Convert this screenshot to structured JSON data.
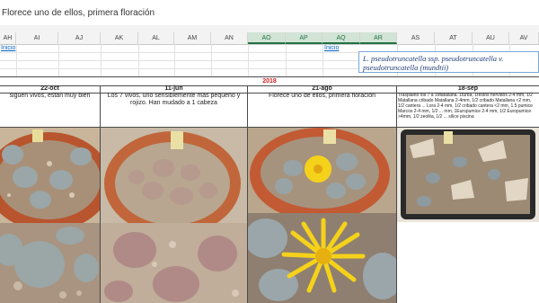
{
  "formula_bar": {
    "value": "Florece uno de ellos, primera floración"
  },
  "columns": [
    "AH",
    "AI",
    "AJ",
    "AK",
    "AL",
    "AM",
    "AN",
    "AO",
    "AP",
    "AQ",
    "AR",
    "AS",
    "AT",
    "AU",
    "AV"
  ],
  "links": {
    "left": "Inicio",
    "right": "Inicio"
  },
  "species_label": "L. pseudotruncatella ssp. pseudotruncatella v. pseudotruncatella (mundtii)",
  "year": "2018",
  "entries": [
    {
      "date": "22-oct",
      "note": "siguen vivos, están muy bien"
    },
    {
      "date": "11-jun",
      "note": "Los 7 vivos, uno sensiblemente más pequeño y rojizo. Han mudado a 1 cabeza"
    },
    {
      "date": "21-ago",
      "note": "Florece uno de ellos, primera floración"
    },
    {
      "date": "18-sep",
      "note": "Trasplanto los 7 a 1Matallana. 1turba, 1restos hervidos 2-4 mm, 1/2 Matallana cribado Matallana 2-4mm, 1/2 cribado Matallana <2 mm, 1/2 cantera ... Lora 2-4 mm, 1/2 cribado cantera <2 mm, 1.5 pumice Marcos 2-4 mm, 1/2 ... mm, 1Europumice 2-4 mm, 1/2 Europumice >4mm, 1/2 zeolita, 1/2 ... sílice piscina"
    }
  ],
  "colors": {
    "link": "#0563c1",
    "year": "#d42020",
    "selected_header": "#217346",
    "flower": "#f5d21a"
  },
  "photo_subjects": [
    "lithops-pot-top",
    "lithops-pot-flower",
    "lithops-tray-stones",
    "lithops-closeup",
    "lithops-closeup-pink",
    "lithops-flower-closeup"
  ]
}
